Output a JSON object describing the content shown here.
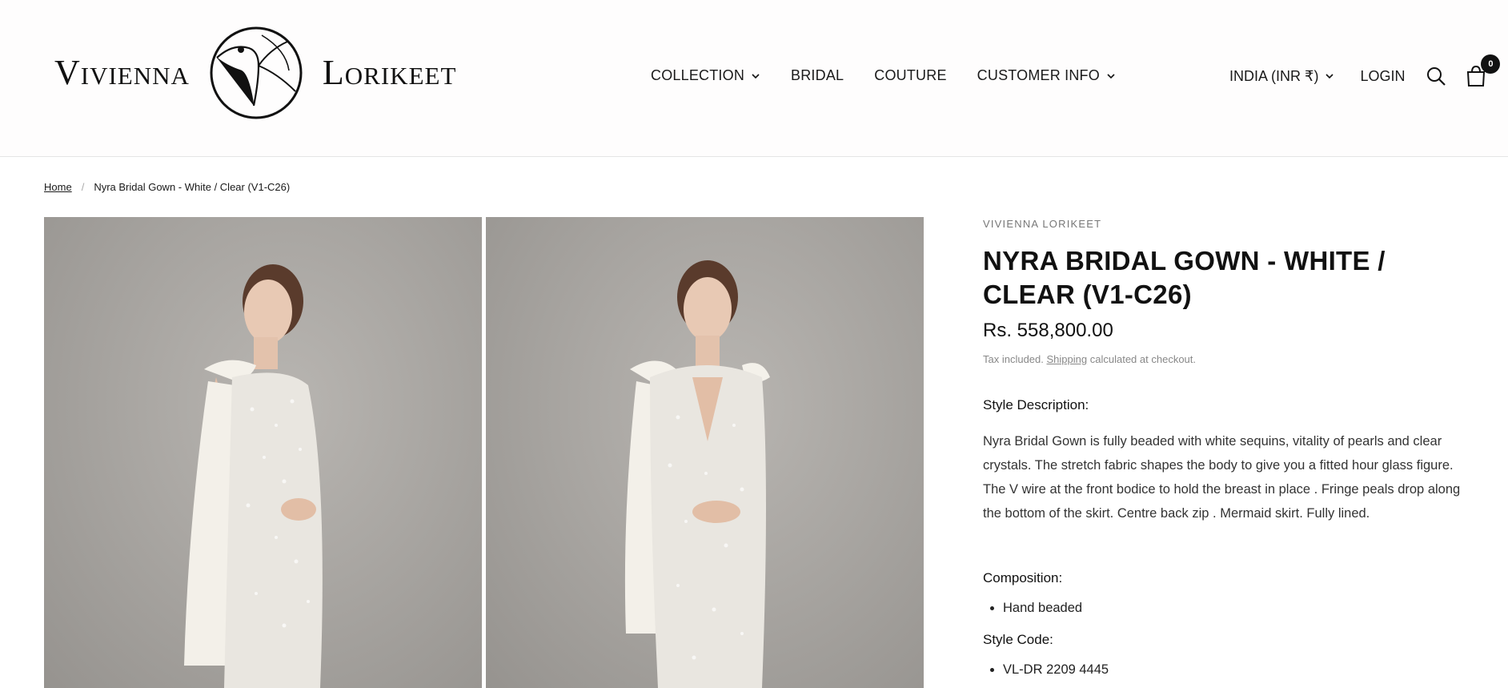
{
  "brand": {
    "word_left": "Vivienna",
    "word_right": "Lorikeet"
  },
  "nav": {
    "items": [
      {
        "label": "COLLECTION",
        "has_dropdown": true
      },
      {
        "label": "BRIDAL",
        "has_dropdown": false
      },
      {
        "label": "COUTURE",
        "has_dropdown": false
      },
      {
        "label": "CUSTOMER INFO",
        "has_dropdown": true
      }
    ]
  },
  "header_right": {
    "currency": "INDIA (INR ₹)",
    "login": "LOGIN",
    "cart_count": "0"
  },
  "breadcrumb": {
    "home": "Home",
    "current": "Nyra Bridal Gown - White / Clear (V1-C26)"
  },
  "product": {
    "vendor": "VIVIENNA LORIKEET",
    "title": "NYRA BRIDAL GOWN - WHITE / CLEAR (V1-C26)",
    "price": "Rs. 558,800.00",
    "tax_prefix": "Tax included.",
    "tax_link": "Shipping",
    "tax_suffix": "calculated at checkout.",
    "style_desc_heading": "Style Description:",
    "style_desc": "Nyra Bridal Gown is fully beaded with white sequins, vitality of pearls and clear crystals.  The stretch fabric shapes the body to give you a fitted hour glass figure. The V wire at the front bodice to hold the breast in place . Fringe peals drop along the bottom of the skirt.  Centre back zip . Mermaid skirt. Fully lined.",
    "composition_heading": "Composition:",
    "composition_items": [
      "Hand beaded"
    ],
    "style_code_heading": "Style Code:",
    "style_code_items": [
      "VL-DR 2209 4445"
    ]
  },
  "colors": {
    "text": "#1a1a1a",
    "muted": "#888888",
    "photo_backdrop": "#a9a6a2"
  }
}
